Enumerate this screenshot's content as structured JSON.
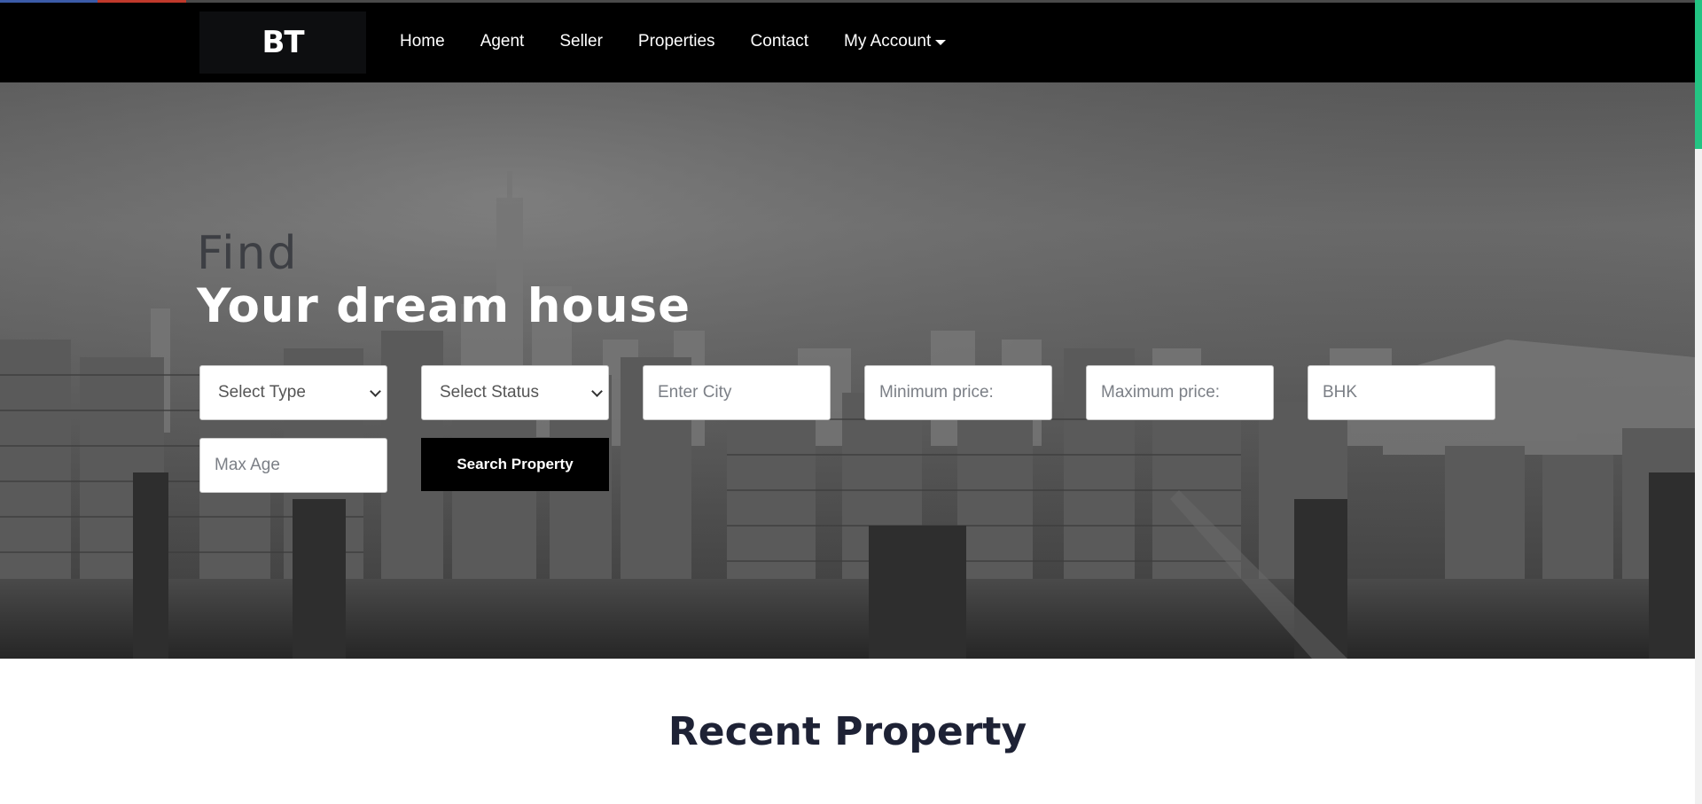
{
  "nav": {
    "logo": "BT",
    "links": [
      "Home",
      "Agent",
      "Seller",
      "Properties",
      "Contact"
    ],
    "account": "My Account"
  },
  "hero": {
    "find": "Find",
    "title": "Your dream house",
    "search": {
      "type_select": "Select Type",
      "status_select": "Select Status",
      "city_placeholder": "Enter City",
      "min_price_placeholder": "Minimum price:",
      "max_price_placeholder": "Maximum price:",
      "bhk_placeholder": "BHK",
      "max_age_placeholder": "Max Age",
      "button": "Search Property"
    }
  },
  "sections": {
    "recent_title": "Recent Property"
  },
  "colors": {
    "navbar": "#000000",
    "scroll_thumb": "#23c483",
    "heading": "#1e2235"
  }
}
